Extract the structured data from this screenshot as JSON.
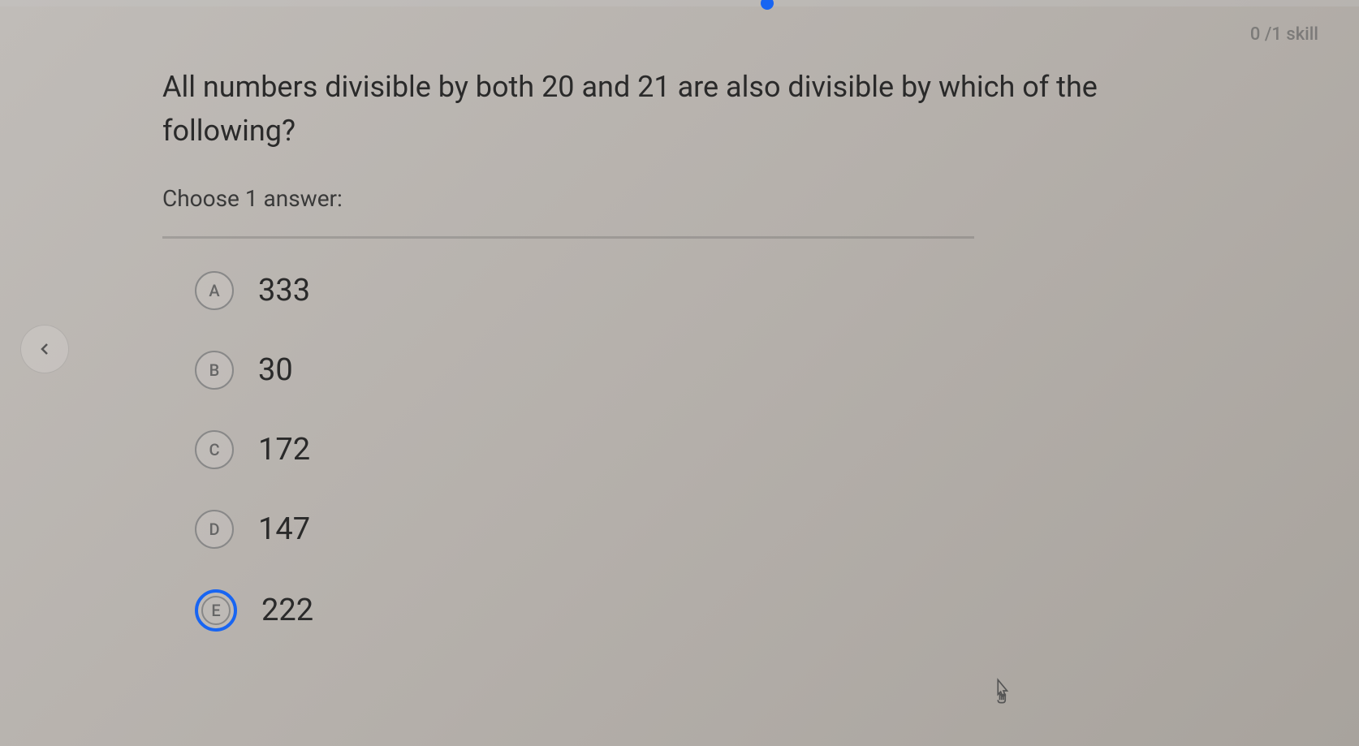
{
  "skillCounter": "0 /1 skill",
  "question": {
    "prefix": "All numbers divisible by both ",
    "num1": "20",
    "mid": " and ",
    "num2": "21",
    "suffix": " are also divisible by which of the following?"
  },
  "instruction": "Choose 1 answer:",
  "answers": [
    {
      "letter": "A",
      "value": "333",
      "selected": false
    },
    {
      "letter": "B",
      "value": "30",
      "selected": false
    },
    {
      "letter": "C",
      "value": "172",
      "selected": false
    },
    {
      "letter": "D",
      "value": "147",
      "selected": false
    },
    {
      "letter": "E",
      "value": "222",
      "selected": true
    }
  ]
}
